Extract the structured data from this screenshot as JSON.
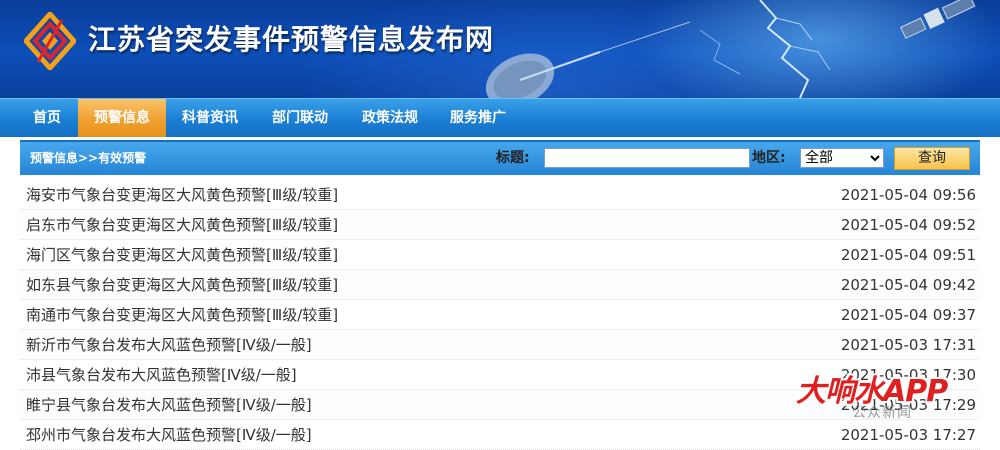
{
  "site": {
    "title": "江苏省突发事件预警信息发布网"
  },
  "nav": {
    "items": [
      {
        "label": "首页"
      },
      {
        "label": "预警信息",
        "active": true
      },
      {
        "label": "科普资讯"
      },
      {
        "label": "部门联动"
      },
      {
        "label": "政策法规"
      },
      {
        "label": "服务推广"
      }
    ]
  },
  "search": {
    "breadcrumb": "预警信息>>有效预警",
    "title_label": "标题:",
    "title_value": "",
    "region_label": "地区:",
    "region_selected": "全部",
    "query_label": "查询"
  },
  "warnings": [
    {
      "title": "海安市气象台变更海区大风黄色预警[Ⅲ级/较重]",
      "time": "2021-05-04 09:56"
    },
    {
      "title": "启东市气象台变更海区大风黄色预警[Ⅲ级/较重]",
      "time": "2021-05-04 09:52"
    },
    {
      "title": "海门区气象台变更海区大风黄色预警[Ⅲ级/较重]",
      "time": "2021-05-04 09:51"
    },
    {
      "title": "如东县气象台变更海区大风黄色预警[Ⅲ级/较重]",
      "time": "2021-05-04 09:42"
    },
    {
      "title": "南通市气象台变更海区大风黄色预警[Ⅲ级/较重]",
      "time": "2021-05-04 09:37"
    },
    {
      "title": "新沂市气象台发布大风蓝色预警[Ⅳ级/一般]",
      "time": "2021-05-03 17:31"
    },
    {
      "title": "沛县气象台发布大风蓝色预警[Ⅳ级/一般]",
      "time": "2021-05-03 17:30"
    },
    {
      "title": "睢宁县气象台发布大风蓝色预警[Ⅳ级/一般]",
      "time": "2021-05-03 17:29"
    },
    {
      "title": "邳州市气象台发布大风蓝色预警[Ⅳ级/一般]",
      "time": "2021-05-03 17:27"
    }
  ],
  "watermark": {
    "brand": "大响水APP",
    "sub": "公众新闻"
  },
  "colors": {
    "banner": "#0d4fb8",
    "nav": "#1a7fd4",
    "nav_active": "#f0a030",
    "bar": "#2585d6",
    "query_button": "#f7c24a",
    "watermark": "#e02020"
  }
}
